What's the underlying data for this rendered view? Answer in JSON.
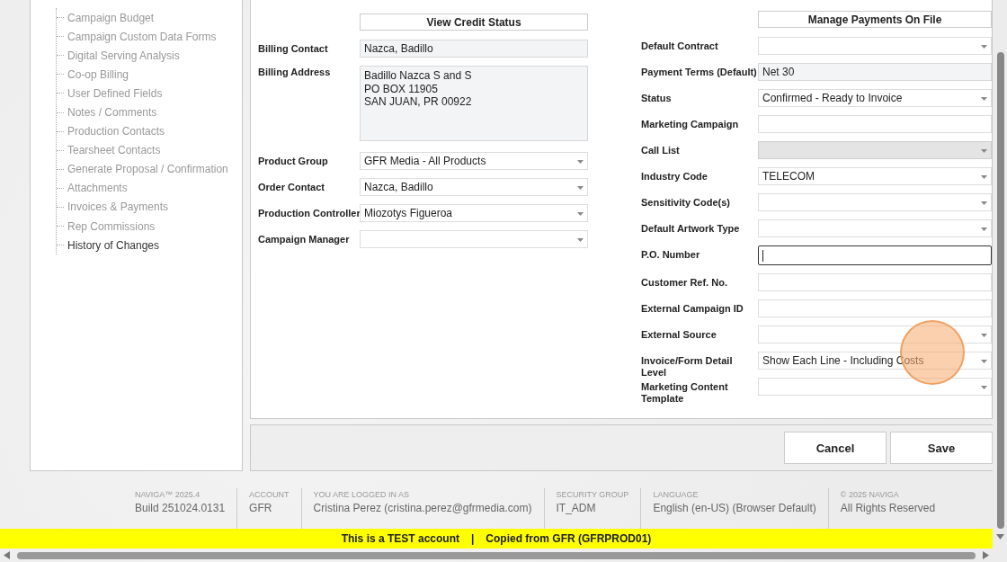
{
  "sidebar": {
    "items": [
      {
        "label": "Campaign Budget",
        "selected": false
      },
      {
        "label": "Campaign Custom Data Forms",
        "selected": false
      },
      {
        "label": "Digital Serving Analysis",
        "selected": false
      },
      {
        "label": "Co-op Billing",
        "selected": false
      },
      {
        "label": "User Defined Fields",
        "selected": false
      },
      {
        "label": "Notes / Comments",
        "selected": false
      },
      {
        "label": "Production Contacts",
        "selected": false
      },
      {
        "label": "Tearsheet Contacts",
        "selected": false
      },
      {
        "label": "Generate Proposal / Confirmation",
        "selected": false
      },
      {
        "label": "Attachments",
        "selected": false
      },
      {
        "label": "Invoices & Payments",
        "selected": false
      },
      {
        "label": "Rep Commissions",
        "selected": false
      },
      {
        "label": "History of Changes",
        "selected": true
      }
    ]
  },
  "left_fields": [
    {
      "kind": "button",
      "label": "View Credit Status"
    },
    {
      "kind": "readonly",
      "label": "Billing Contact",
      "value": "Nazca, Badillo"
    },
    {
      "kind": "textarea",
      "label": "Billing Address",
      "lines": [
        "Badillo Nazca S and S",
        "PO BOX 11905",
        "SAN JUAN, PR 00922"
      ]
    },
    {
      "kind": "select",
      "label": "Product Group",
      "value": "GFR Media - All Products"
    },
    {
      "kind": "select",
      "label": "Order Contact",
      "value": "Nazca, Badillo"
    },
    {
      "kind": "select",
      "label": "Production Controller",
      "value": "Miozotys Figueroa"
    },
    {
      "kind": "select",
      "label": "Campaign Manager"
    }
  ],
  "right_fields": [
    {
      "kind": "button",
      "label": "Manage Payments On File",
      "disabled": false,
      "focused": false
    },
    {
      "kind": "select",
      "label": "Default Contract",
      "disabled": false,
      "focused": false
    },
    {
      "kind": "readonly",
      "label": "Payment Terms (Default)",
      "value": "Net 30",
      "disabled": false,
      "focused": false
    },
    {
      "kind": "select",
      "label": "Status",
      "value": "Confirmed - Ready to Invoice",
      "disabled": false,
      "focused": false
    },
    {
      "kind": "input",
      "label": "Marketing Campaign",
      "disabled": false,
      "focused": false
    },
    {
      "kind": "select",
      "label": "Call List",
      "disabled": true,
      "focused": false
    },
    {
      "kind": "select",
      "label": "Industry Code",
      "value": "TELECOM",
      "disabled": false,
      "focused": false
    },
    {
      "kind": "select",
      "label": "Sensitivity Code(s)",
      "disabled": false,
      "focused": false
    },
    {
      "kind": "select",
      "label": "Default Artwork Type",
      "disabled": false,
      "focused": false
    },
    {
      "kind": "input",
      "label": "P.O. Number",
      "disabled": false,
      "focused": true
    },
    {
      "kind": "input",
      "label": "Customer Ref. No.",
      "disabled": false,
      "focused": false
    },
    {
      "kind": "input",
      "label": "External Campaign ID",
      "disabled": false,
      "focused": false
    },
    {
      "kind": "select",
      "label": "External Source",
      "disabled": false,
      "focused": false
    },
    {
      "kind": "select",
      "label": "Invoice/Form Detail Level",
      "value": "Show Each Line - Including Costs",
      "disabled": false,
      "focused": false
    },
    {
      "kind": "select",
      "label": "Marketing Content Template",
      "disabled": false,
      "focused": false
    }
  ],
  "actions": [
    "Cancel",
    "Save"
  ],
  "footer": [
    {
      "caption": "NAVIGA™ 2025.4",
      "value": "Build 251024.0131"
    },
    {
      "caption": "ACCOUNT",
      "value": "GFR"
    },
    {
      "caption": "YOU ARE LOGGED IN AS",
      "value": "Cristina Perez (cristina.perez@gfrmedia.com)"
    },
    {
      "caption": "SECURITY GROUP",
      "value": "IT_ADM"
    },
    {
      "caption": "LANGUAGE",
      "value": "English (en-US) (Browser Default)"
    },
    {
      "caption": "© 2025 NAVIGA",
      "value": "All Rights Reserved"
    }
  ],
  "banner": [
    "This is a TEST account",
    "|",
    "Copied from GFR (GFRPROD01)"
  ]
}
